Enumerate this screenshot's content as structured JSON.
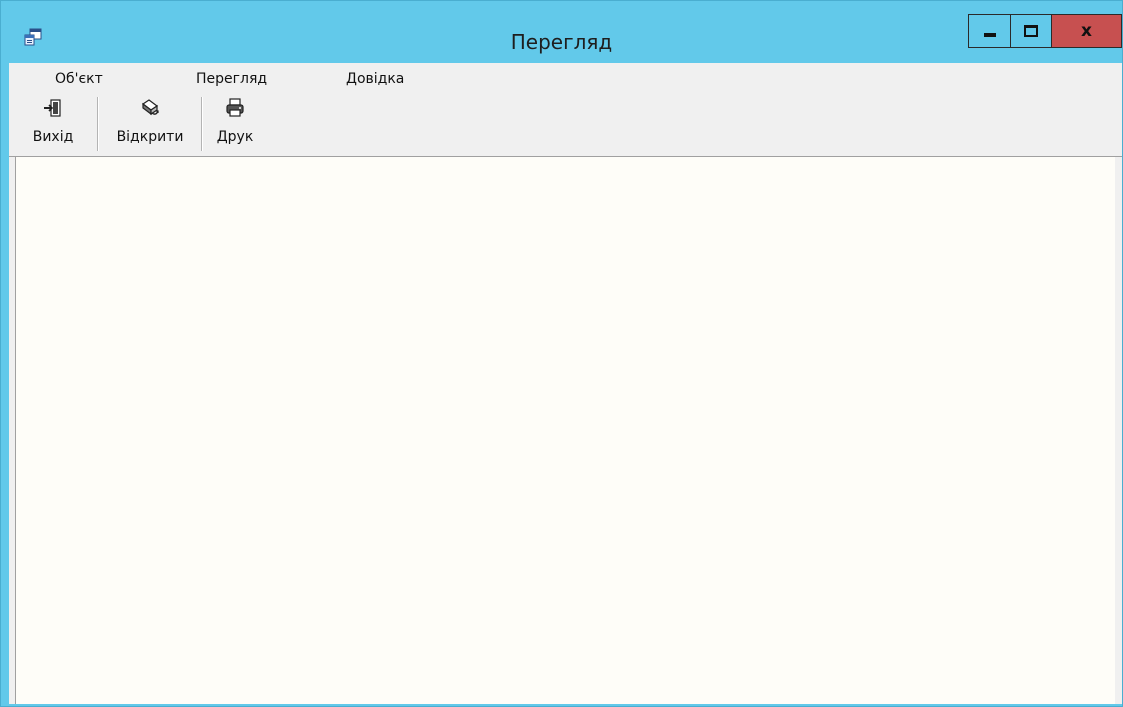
{
  "window": {
    "title": "Перегляд",
    "accent_color": "#62c9ea",
    "close_color": "#c75050",
    "app_icon": "app-window-icon",
    "controls": {
      "minimize_icon": "minimize-icon",
      "maximize_icon": "maximize-icon",
      "close_icon": "close-icon",
      "close_glyph": "x"
    }
  },
  "menu": {
    "items": [
      {
        "label": "Об'єкт"
      },
      {
        "label": "Перегляд"
      },
      {
        "label": "Довідка"
      }
    ]
  },
  "toolbar": {
    "buttons": [
      {
        "label": "Вихід",
        "icon": "exit-icon"
      },
      {
        "label": "Відкрити",
        "icon": "open-icon"
      },
      {
        "label": "Друк",
        "icon": "print-icon"
      }
    ]
  },
  "content": {
    "background": "#fefdf8"
  }
}
